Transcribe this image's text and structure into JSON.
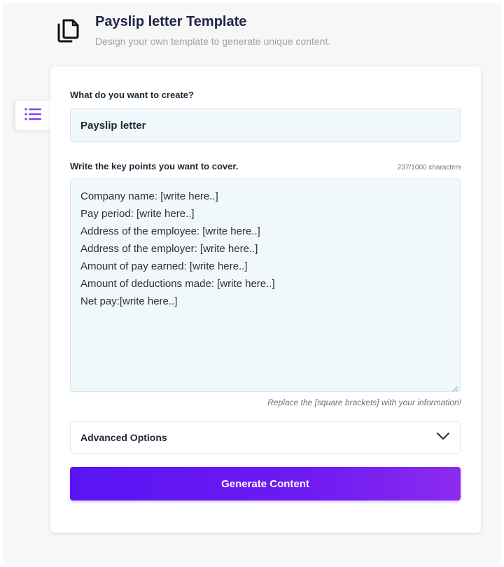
{
  "header": {
    "title": "Payslip letter Template",
    "subtitle": "Design your own template to generate unique content.",
    "icon": "copy-document-icon"
  },
  "sidebar": {
    "toggle_icon": "list-menu-icon",
    "accent_color": "#7c3aed"
  },
  "form": {
    "create_label": "What do you want to create?",
    "create_value": "Payslip letter",
    "keypoints_label": "Write the key points you want to cover.",
    "char_count": "237/1000 characters",
    "keypoints_lines": [
      "Company name: [write here..]",
      "Pay period: [write here..]",
      "Address of the employee: [write here..]",
      "Address of the employer: [write here..]",
      "Amount of pay earned: [write here..]",
      "Amount of deductions made: [write here..]",
      "Net pay:[write here..]"
    ],
    "hint": "Replace the [square brackets] with your information!",
    "advanced_label": "Advanced Options",
    "generate_label": "Generate Content"
  },
  "colors": {
    "primary": "#5a14f4",
    "primary_end": "#8b2bef",
    "input_bg": "#f0f8fc"
  }
}
